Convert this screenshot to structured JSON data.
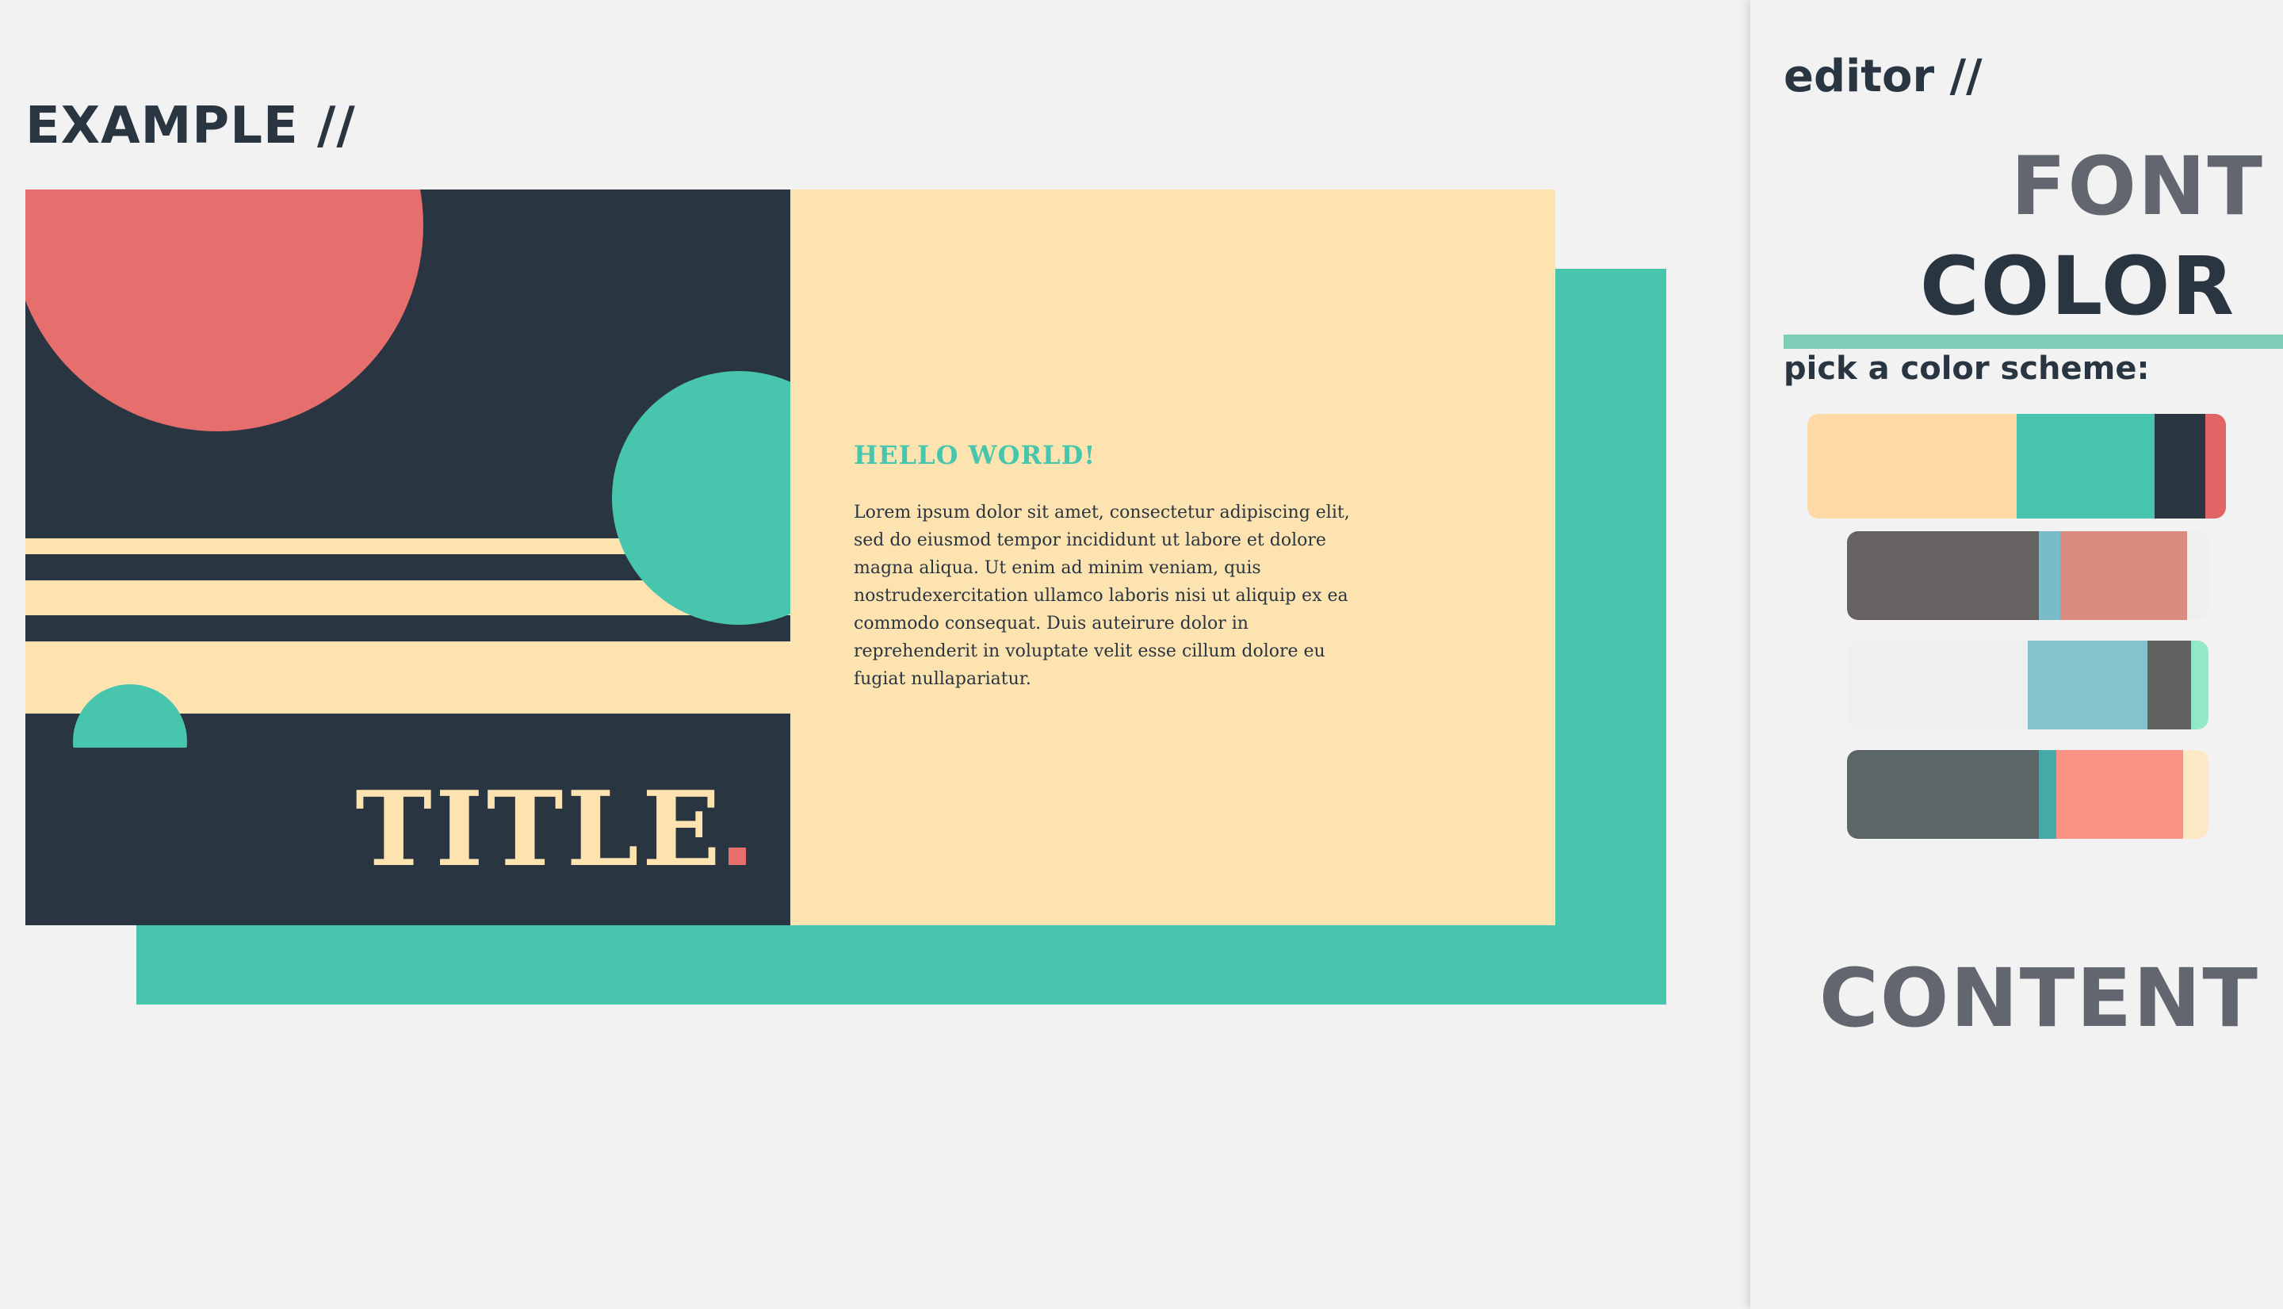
{
  "example": {
    "heading": "EXAMPLE //",
    "card": {
      "title": "TITLE",
      "hello": "HELLO WORLD!",
      "body": "Lorem ipsum dolor sit amet, consectetur adipiscing elit, sed do eiusmod tempor incididunt ut labore et dolore magna aliqua. Ut enim ad minim veniam, quis nostrudexercitation ullamco laboris nisi ut aliquip ex ea commodo consequat. Duis auteirure dolor in reprehenderit in voluptate velit esse cillum dolore eu fugiat nullapariatur."
    }
  },
  "colors": {
    "dark": "#2a3542",
    "cream": "#fde3b0",
    "teal": "#47c6ad",
    "coral": "#e66e6c"
  },
  "editor": {
    "heading": "editor //",
    "sections": {
      "font": "FONT",
      "color": "COLOR",
      "content": "CONTENT"
    },
    "underline_color": "#7ecdb9",
    "pick_label": "pick a color scheme:",
    "schemes": [
      {
        "name": "scheme-1",
        "colors": [
          "#fdd9a6",
          "#47c6ad",
          "#2a3542",
          "#e06564"
        ],
        "weights": [
          50,
          33,
          12,
          5
        ]
      },
      {
        "name": "scheme-2",
        "colors": [
          "#676262",
          "#79bcc7",
          "#da8c81",
          "#efefef"
        ],
        "weights": [
          53,
          6,
          35,
          6
        ]
      },
      {
        "name": "scheme-3",
        "colors": [
          "#efefef",
          "#82c3cd",
          "#626262",
          "#93e8c5"
        ],
        "weights": [
          53,
          35,
          13,
          5
        ]
      },
      {
        "name": "scheme-4",
        "colors": [
          "#5c6667",
          "#47a9a5",
          "#f89284",
          "#fde8c6"
        ],
        "weights": [
          53,
          5,
          35,
          7
        ]
      }
    ]
  }
}
